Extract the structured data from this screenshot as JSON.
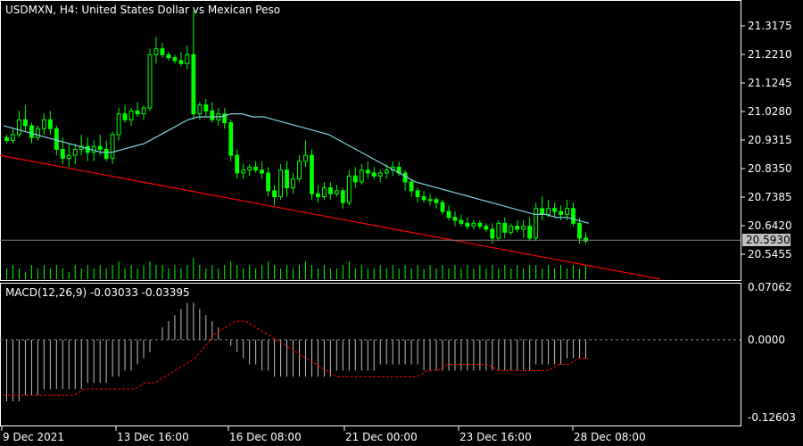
{
  "chart_data": [
    {
      "type": "candlestick",
      "title": "USDMXN, H4:  United States Dollar vs Mexican Peso",
      "current_price": "20.5930",
      "y_ticks": [
        "21.3175",
        "21.2210",
        "21.1245",
        "21.0280",
        "20.9315",
        "20.8350",
        "20.7385",
        "20.6420",
        "20.5455"
      ],
      "ylim": [
        20.5,
        21.4
      ],
      "x_ticks": [
        "9 Dec 2021",
        "13 Dec 16:00",
        "16 Dec 08:00",
        "21 Dec 00:00",
        "23 Dec 16:00",
        "28 Dec 08:00"
      ],
      "candles": [
        [
          20.94,
          20.95,
          20.92,
          20.93
        ],
        [
          20.93,
          20.97,
          20.92,
          20.95
        ],
        [
          20.95,
          21.03,
          20.94,
          21.0
        ],
        [
          21.0,
          21.05,
          20.96,
          20.98
        ],
        [
          20.98,
          20.99,
          20.92,
          20.94
        ],
        [
          20.94,
          20.98,
          20.93,
          20.97
        ],
        [
          20.97,
          21.02,
          20.95,
          21.0
        ],
        [
          21.0,
          21.03,
          20.95,
          20.97
        ],
        [
          20.97,
          20.98,
          20.88,
          20.9
        ],
        [
          20.9,
          20.94,
          20.85,
          20.87
        ],
        [
          20.87,
          20.92,
          20.84,
          20.88
        ],
        [
          20.88,
          20.92,
          20.85,
          20.9
        ],
        [
          20.9,
          20.95,
          20.88,
          20.91
        ],
        [
          20.91,
          20.94,
          20.86,
          20.89
        ],
        [
          20.89,
          20.93,
          20.86,
          20.91
        ],
        [
          20.91,
          20.95,
          20.88,
          20.9
        ],
        [
          20.9,
          20.93,
          20.86,
          20.87
        ],
        [
          20.87,
          20.96,
          20.85,
          20.95
        ],
        [
          20.95,
          21.04,
          20.93,
          21.02
        ],
        [
          21.02,
          21.05,
          20.99,
          21.0
        ],
        [
          21.0,
          21.04,
          20.98,
          21.03
        ],
        [
          21.03,
          21.06,
          21.01,
          21.02
        ],
        [
          21.02,
          21.05,
          21.0,
          21.04
        ],
        [
          21.04,
          21.24,
          21.03,
          21.22
        ],
        [
          21.22,
          21.28,
          21.19,
          21.24
        ],
        [
          21.24,
          21.26,
          21.21,
          21.22
        ],
        [
          21.22,
          21.23,
          21.2,
          21.21
        ],
        [
          21.21,
          21.22,
          21.19,
          21.2
        ],
        [
          21.2,
          21.23,
          21.18,
          21.19
        ],
        [
          21.19,
          21.25,
          21.17,
          21.22
        ],
        [
          21.22,
          21.37,
          21.0,
          21.02
        ],
        [
          21.02,
          21.06,
          21.0,
          21.05
        ],
        [
          21.05,
          21.07,
          21.01,
          21.03
        ],
        [
          21.03,
          21.06,
          20.99,
          21.0
        ],
        [
          21.0,
          21.04,
          20.98,
          21.02
        ],
        [
          21.02,
          21.04,
          20.97,
          20.99
        ],
        [
          20.99,
          21.0,
          20.86,
          20.88
        ],
        [
          20.88,
          20.9,
          20.8,
          20.82
        ],
        [
          20.82,
          20.85,
          20.8,
          20.83
        ],
        [
          20.83,
          20.85,
          20.81,
          20.84
        ],
        [
          20.84,
          20.86,
          20.82,
          20.83
        ],
        [
          20.83,
          20.86,
          20.8,
          20.82
        ],
        [
          20.82,
          20.84,
          20.74,
          20.76
        ],
        [
          20.76,
          20.78,
          20.71,
          20.74
        ],
        [
          20.74,
          20.85,
          20.73,
          20.83
        ],
        [
          20.83,
          20.86,
          20.74,
          20.77
        ],
        [
          20.77,
          20.82,
          20.75,
          20.8
        ],
        [
          20.8,
          20.88,
          20.79,
          20.86
        ],
        [
          20.86,
          20.93,
          20.84,
          20.88
        ],
        [
          20.88,
          20.9,
          20.73,
          20.75
        ],
        [
          20.75,
          20.78,
          20.72,
          20.74
        ],
        [
          20.74,
          20.79,
          20.73,
          20.77
        ],
        [
          20.77,
          20.79,
          20.73,
          20.75
        ],
        [
          20.75,
          20.78,
          20.74,
          20.76
        ],
        [
          20.76,
          20.77,
          20.7,
          20.72
        ],
        [
          20.72,
          20.83,
          20.71,
          20.81
        ],
        [
          20.81,
          20.84,
          20.77,
          20.79
        ],
        [
          20.79,
          20.85,
          20.78,
          20.83
        ],
        [
          20.83,
          20.86,
          20.8,
          20.82
        ],
        [
          20.82,
          20.84,
          20.8,
          20.81
        ],
        [
          20.81,
          20.83,
          20.79,
          20.82
        ],
        [
          20.82,
          20.85,
          20.8,
          20.83
        ],
        [
          20.83,
          20.86,
          20.81,
          20.84
        ],
        [
          20.84,
          20.86,
          20.81,
          20.82
        ],
        [
          20.82,
          20.83,
          20.76,
          20.79
        ],
        [
          20.79,
          20.8,
          20.74,
          20.76
        ],
        [
          20.76,
          20.77,
          20.72,
          20.74
        ],
        [
          20.74,
          20.76,
          20.72,
          20.73
        ],
        [
          20.73,
          20.75,
          20.71,
          20.73
        ],
        [
          20.73,
          20.74,
          20.7,
          20.72
        ],
        [
          20.72,
          20.73,
          20.68,
          20.69
        ],
        [
          20.69,
          20.71,
          20.66,
          20.67
        ],
        [
          20.67,
          20.69,
          20.64,
          20.66
        ],
        [
          20.66,
          20.68,
          20.64,
          20.65
        ],
        [
          20.65,
          20.67,
          20.63,
          20.64
        ],
        [
          20.64,
          20.66,
          20.63,
          20.65
        ],
        [
          20.65,
          20.66,
          20.63,
          20.64
        ],
        [
          20.64,
          20.65,
          20.62,
          20.63
        ],
        [
          20.63,
          20.65,
          20.58,
          20.6
        ],
        [
          20.6,
          20.66,
          20.59,
          20.65
        ],
        [
          20.65,
          20.67,
          20.6,
          20.62
        ],
        [
          20.62,
          20.65,
          20.61,
          20.64
        ],
        [
          20.64,
          20.66,
          20.62,
          20.63
        ],
        [
          20.63,
          20.66,
          20.6,
          20.64
        ],
        [
          20.64,
          20.67,
          20.59,
          20.6
        ],
        [
          20.6,
          20.72,
          20.59,
          20.7
        ],
        [
          20.7,
          20.74,
          20.66,
          20.68
        ],
        [
          20.68,
          20.73,
          20.67,
          20.7
        ],
        [
          20.7,
          20.72,
          20.67,
          20.69
        ],
        [
          20.69,
          20.71,
          20.66,
          20.68
        ],
        [
          20.68,
          20.73,
          20.66,
          20.7
        ],
        [
          20.7,
          20.72,
          20.64,
          20.65
        ],
        [
          20.65,
          20.67,
          20.58,
          20.6
        ],
        [
          20.6,
          20.62,
          20.58,
          20.59
        ]
      ],
      "moving_average": [
        20.98,
        20.97,
        20.96,
        20.95,
        20.94,
        20.93,
        20.92,
        20.91,
        20.9,
        20.89,
        20.89,
        20.9,
        20.91,
        20.92,
        20.94,
        20.96,
        20.98,
        21.0,
        21.01,
        21.01,
        21.01,
        21.02,
        21.02,
        21.01,
        21.01,
        21.0,
        20.99,
        20.98,
        20.97,
        20.96,
        20.95,
        20.93,
        20.91,
        20.89,
        20.87,
        20.85,
        20.83,
        20.81,
        20.79,
        20.78,
        20.77,
        20.76,
        20.75,
        20.74,
        20.73,
        20.72,
        20.71,
        20.7,
        20.69,
        20.68,
        20.68,
        20.67,
        20.67,
        20.66,
        20.65
      ],
      "trendline": [
        [
          0,
          20.88
        ],
        [
          1,
          20.54
        ]
      ],
      "volume": [
        3,
        4,
        3,
        2,
        4,
        3,
        4,
        3,
        4,
        3,
        2,
        4,
        3,
        4,
        3,
        4,
        3,
        4,
        5,
        3,
        4,
        3,
        4,
        5,
        4,
        4,
        3,
        4,
        3,
        4,
        6,
        4,
        3,
        4,
        3,
        4,
        5,
        4,
        3,
        4,
        3,
        4,
        5,
        4,
        3,
        4,
        3,
        4,
        5,
        4,
        3,
        4,
        3,
        3,
        4,
        5,
        3,
        4,
        3,
        3,
        4,
        3,
        4,
        3,
        4,
        3,
        4,
        3,
        4,
        3,
        4,
        3,
        4,
        3,
        4,
        3,
        4,
        3,
        4,
        3,
        4,
        3,
        4,
        3,
        4,
        4,
        3,
        4,
        3,
        4,
        3,
        4,
        3,
        4
      ]
    },
    {
      "type": "macd",
      "label": "MACD(12,26,9) -0.03033 -0.03395",
      "y_ticks": [
        "0.07062",
        "0.0000",
        "-0.12603"
      ],
      "ylim": [
        -0.13,
        0.075
      ],
      "histogram": [
        -0.1,
        -0.1,
        -0.1,
        -0.09,
        -0.09,
        -0.09,
        -0.08,
        -0.08,
        -0.08,
        -0.08,
        -0.08,
        -0.08,
        -0.08,
        -0.07,
        -0.07,
        -0.07,
        -0.07,
        -0.06,
        -0.06,
        -0.05,
        -0.05,
        -0.04,
        -0.03,
        -0.02,
        0.0,
        0.02,
        0.03,
        0.04,
        0.05,
        0.06,
        0.06,
        0.05,
        0.04,
        0.03,
        0.02,
        0.0,
        -0.01,
        -0.02,
        -0.03,
        -0.04,
        -0.04,
        -0.05,
        -0.05,
        -0.06,
        -0.06,
        -0.06,
        -0.06,
        -0.06,
        -0.06,
        -0.06,
        -0.06,
        -0.06,
        -0.06,
        -0.05,
        -0.05,
        -0.05,
        -0.05,
        -0.05,
        -0.05,
        -0.05,
        -0.04,
        -0.04,
        -0.04,
        -0.04,
        -0.04,
        -0.04,
        -0.04,
        -0.05,
        -0.05,
        -0.05,
        -0.05,
        -0.05,
        -0.05,
        -0.05,
        -0.05,
        -0.05,
        -0.05,
        -0.05,
        -0.05,
        -0.05,
        -0.05,
        -0.05,
        -0.05,
        -0.05,
        -0.05,
        -0.04,
        -0.04,
        -0.04,
        -0.04,
        -0.04,
        -0.03,
        -0.03,
        -0.03,
        -0.03
      ],
      "signal": [
        -0.09,
        -0.09,
        -0.09,
        -0.09,
        -0.09,
        -0.09,
        -0.09,
        -0.09,
        -0.08,
        -0.08,
        -0.08,
        -0.08,
        -0.08,
        -0.08,
        -0.07,
        -0.07,
        -0.06,
        -0.05,
        -0.04,
        -0.03,
        -0.01,
        0.01,
        0.02,
        0.03,
        0.03,
        0.02,
        0.01,
        0.0,
        -0.01,
        -0.02,
        -0.03,
        -0.04,
        -0.05,
        -0.06,
        -0.06,
        -0.06,
        -0.06,
        -0.06,
        -0.06,
        -0.06,
        -0.06,
        -0.06,
        -0.05,
        -0.05,
        -0.04,
        -0.04,
        -0.04,
        -0.04,
        -0.04,
        -0.05,
        -0.05,
        -0.05,
        -0.05,
        -0.05,
        -0.05,
        -0.04,
        -0.04,
        -0.03,
        -0.03
      ]
    }
  ],
  "colors": {
    "background": "#000000",
    "frame": "#ffffff",
    "candle": "#00ff00",
    "moving_average": "#80d0e0",
    "trendline": "#ff0000",
    "price_line": "#808080",
    "histogram": "#c0c0c0",
    "signal": "#ff0000"
  }
}
